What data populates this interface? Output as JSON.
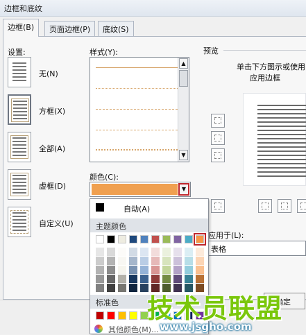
{
  "window": {
    "title": "边框和底纹"
  },
  "tabs": [
    {
      "label": "边框(B)",
      "active": true
    },
    {
      "label": "页面边框(P)",
      "active": false
    },
    {
      "label": "底纹(S)",
      "active": false
    }
  ],
  "settings": {
    "label": "设置:",
    "items": [
      {
        "label": "无(N)"
      },
      {
        "label": "方框(X)"
      },
      {
        "label": "全部(A)"
      },
      {
        "label": "虚框(D)"
      },
      {
        "label": "自定义(U)"
      }
    ]
  },
  "style": {
    "label": "样式(Y):"
  },
  "color": {
    "label": "颜色(C):",
    "selected": "#f0a050"
  },
  "preview": {
    "label": "预览",
    "hint_line1": "单击下方图示或使用",
    "hint_line2": "应用边框"
  },
  "apply_to": {
    "label": "应用于(L):",
    "value": "表格"
  },
  "buttons": {
    "ok": "确定"
  },
  "color_menu": {
    "auto_label": "自动(A)",
    "theme_header": "主题颜色",
    "standard_header": "标准色",
    "more_label": "其他颜色(M)...",
    "theme_colors": [
      "#ffffff",
      "#000000",
      "#eeece1",
      "#1f497d",
      "#4f81bd",
      "#c0504d",
      "#9bbb59",
      "#8064a2",
      "#4bacc6",
      "#f79646"
    ],
    "standard_colors": [
      "#c00000",
      "#ff0000",
      "#ffc000",
      "#ffff00",
      "#92d050",
      "#00b050",
      "#00b0f0",
      "#0070c0",
      "#002060",
      "#7030a0"
    ]
  },
  "watermark": {
    "title": "技术员联盟",
    "url": "www.jsgho.com"
  }
}
